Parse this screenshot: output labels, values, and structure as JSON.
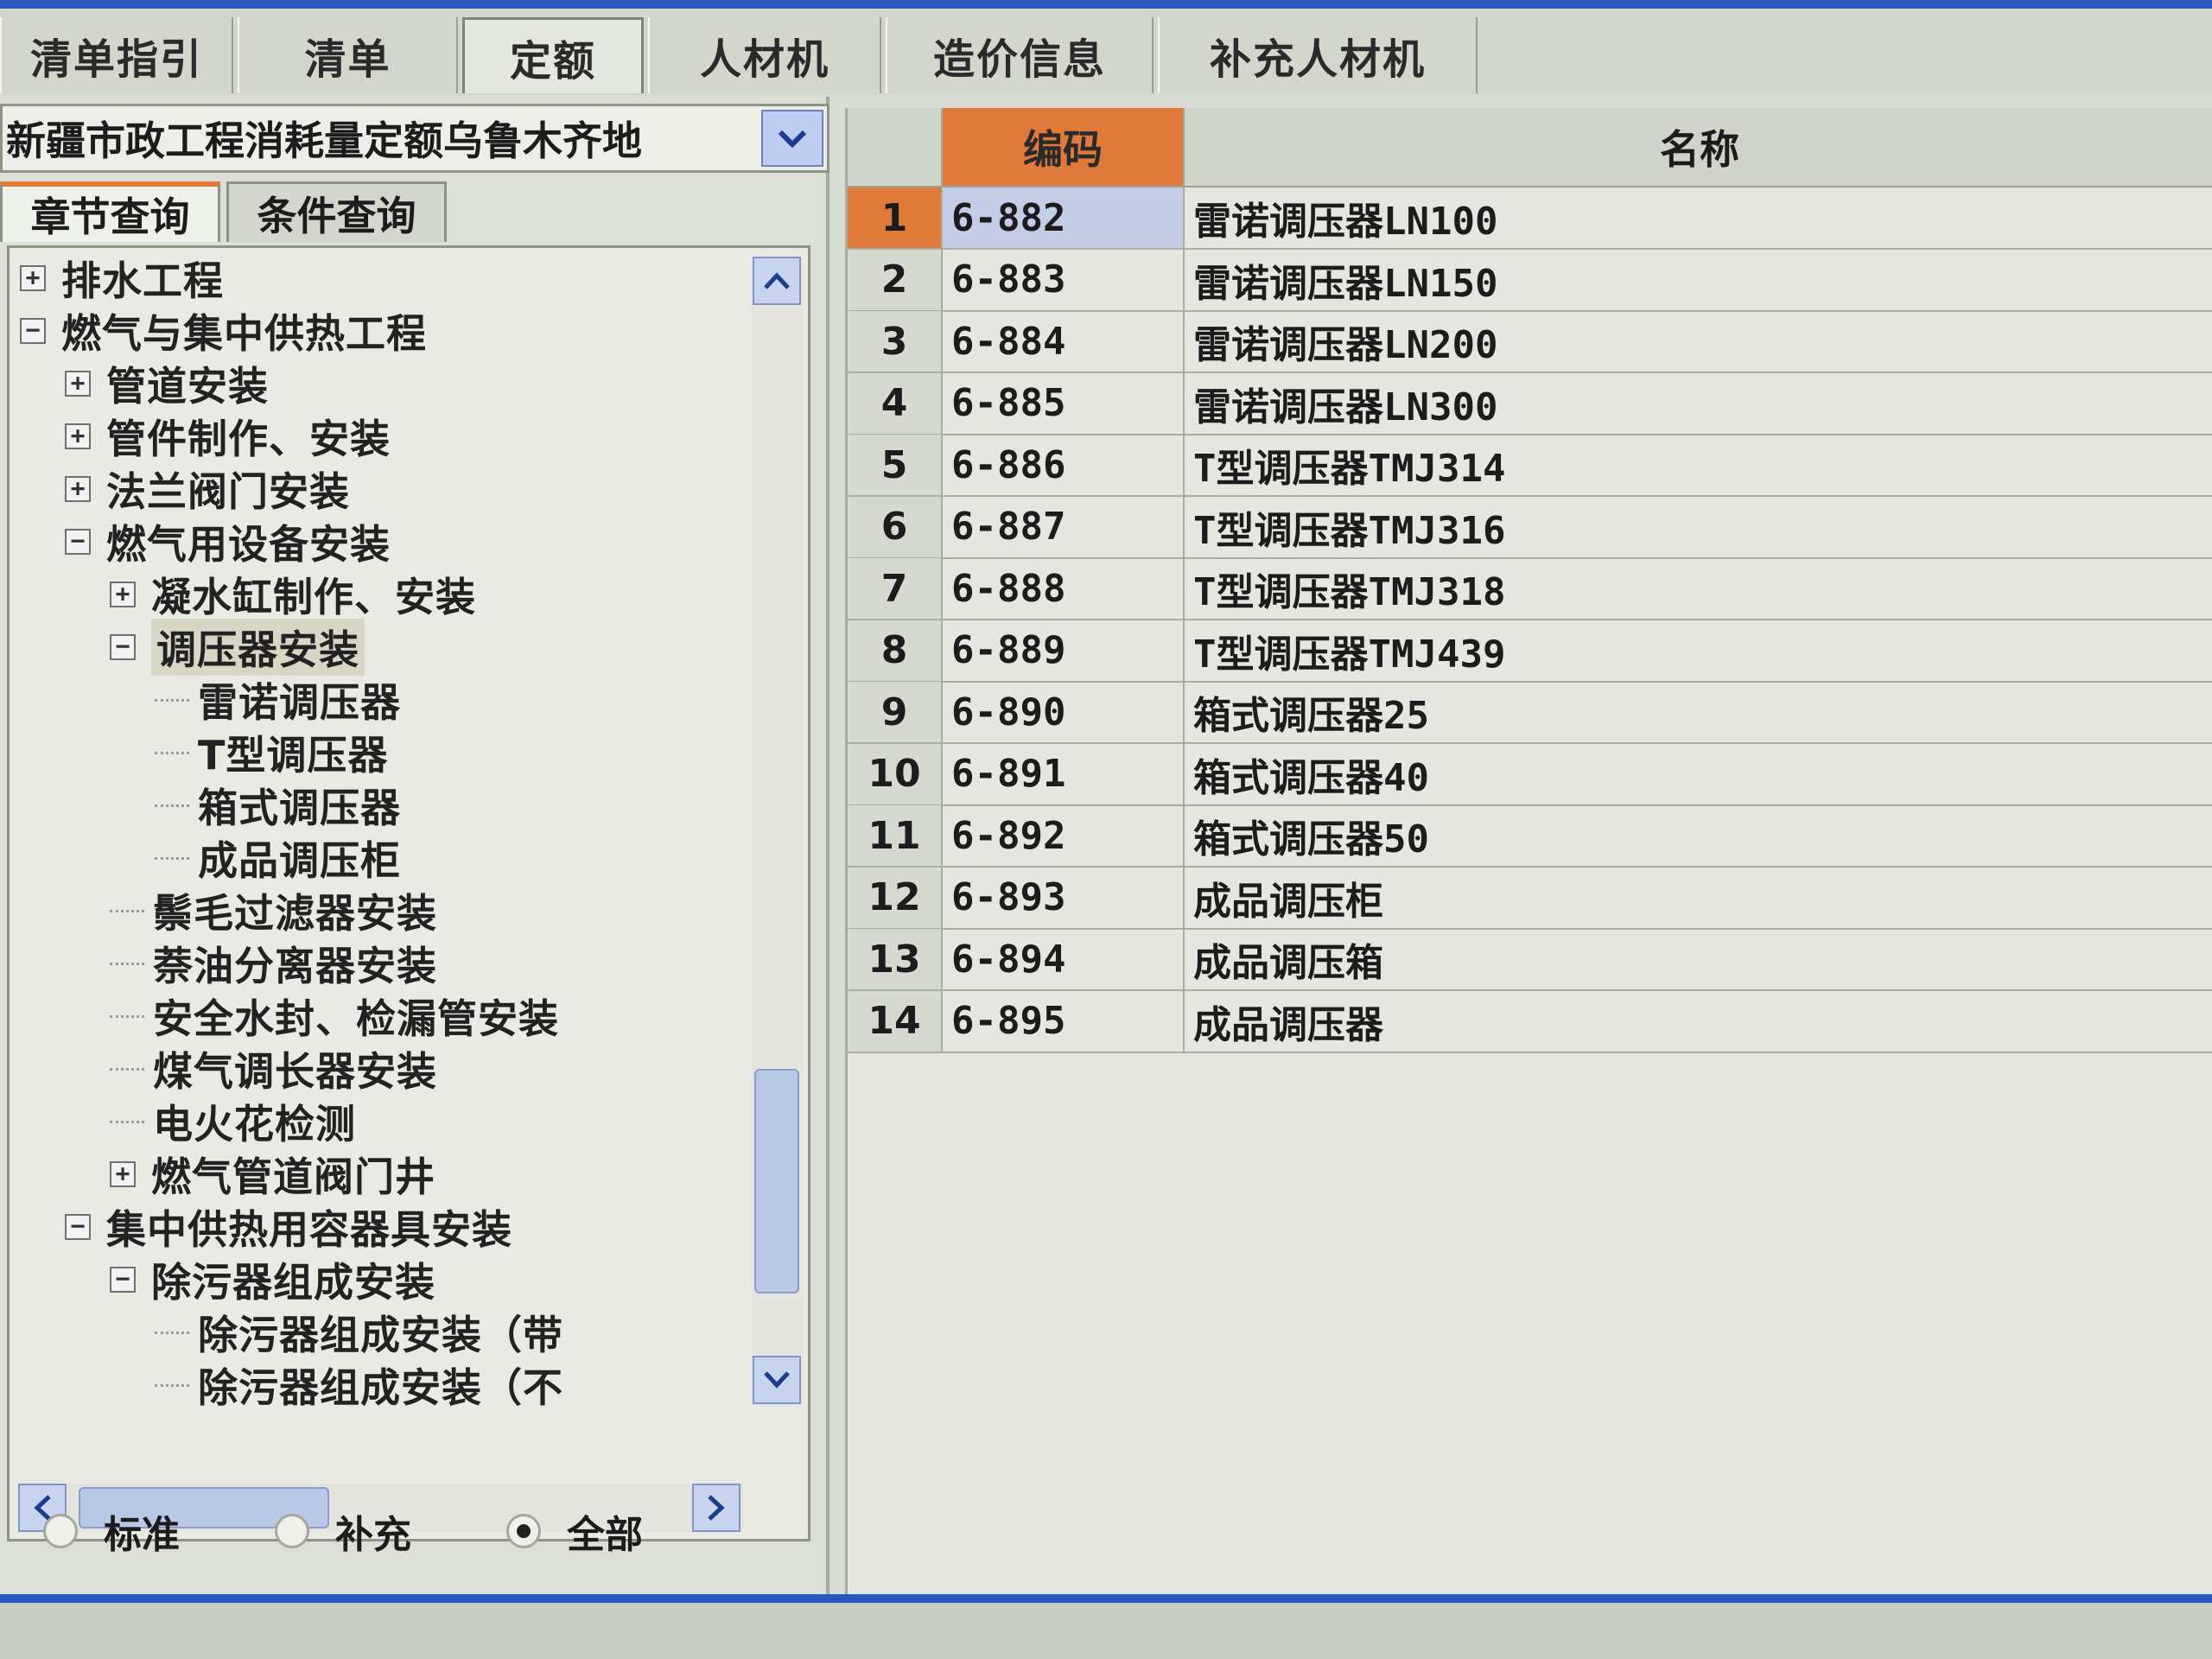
{
  "tabs": [
    {
      "label": "清单指引"
    },
    {
      "label": "清单"
    },
    {
      "label": "定额"
    },
    {
      "label": "人材机"
    },
    {
      "label": "造价信息"
    },
    {
      "label": "补充人材机"
    }
  ],
  "active_tab": "定额",
  "dropdown": {
    "value": "新疆市政工程消耗量定额乌鲁木齐地"
  },
  "query_tabs": [
    {
      "label": "章节查询"
    },
    {
      "label": "条件查询"
    }
  ],
  "tree": [
    {
      "label": "排水工程",
      "level": 0,
      "toggle": "+"
    },
    {
      "label": "燃气与集中供热工程",
      "level": 0,
      "toggle": "-"
    },
    {
      "label": "管道安装",
      "level": 1,
      "toggle": "+"
    },
    {
      "label": "管件制作、安装",
      "level": 1,
      "toggle": "+"
    },
    {
      "label": "法兰阀门安装",
      "level": 1,
      "toggle": "+"
    },
    {
      "label": "燃气用设备安装",
      "level": 1,
      "toggle": "-"
    },
    {
      "label": "凝水缸制作、安装",
      "level": 2,
      "toggle": "+"
    },
    {
      "label": "调压器安装",
      "level": 2,
      "toggle": "-",
      "selected": true
    },
    {
      "label": "雷诺调压器",
      "level": 3,
      "toggle": ""
    },
    {
      "label": "T型调压器",
      "level": 3,
      "toggle": ""
    },
    {
      "label": "箱式调压器",
      "level": 3,
      "toggle": ""
    },
    {
      "label": "成品调压柜",
      "level": 3,
      "toggle": ""
    },
    {
      "label": "鬃毛过滤器安装",
      "level": 2,
      "toggle": ""
    },
    {
      "label": "萘油分离器安装",
      "level": 2,
      "toggle": ""
    },
    {
      "label": "安全水封、检漏管安装",
      "level": 2,
      "toggle": ""
    },
    {
      "label": "煤气调长器安装",
      "level": 2,
      "toggle": ""
    },
    {
      "label": "电火花检测",
      "level": 2,
      "toggle": ""
    },
    {
      "label": "燃气管道阀门井",
      "level": 2,
      "toggle": "+"
    },
    {
      "label": "集中供热用容器具安装",
      "level": 1,
      "toggle": "-"
    },
    {
      "label": "除污器组成安装",
      "level": 2,
      "toggle": "-"
    },
    {
      "label": "除污器组成安装（带",
      "level": 3,
      "toggle": ""
    },
    {
      "label": "除污器组成安装（不",
      "level": 3,
      "toggle": ""
    }
  ],
  "radios": [
    {
      "label": "标准",
      "checked": false
    },
    {
      "label": "补充",
      "checked": false
    },
    {
      "label": "全部",
      "checked": true
    }
  ],
  "grid": {
    "headers": {
      "index": "",
      "code": "编码",
      "name": "名称"
    },
    "rows": [
      {
        "index": "1",
        "code": "6-882",
        "name": "雷诺调压器LN100"
      },
      {
        "index": "2",
        "code": "6-883",
        "name": "雷诺调压器LN150"
      },
      {
        "index": "3",
        "code": "6-884",
        "name": "雷诺调压器LN200"
      },
      {
        "index": "4",
        "code": "6-885",
        "name": "雷诺调压器LN300"
      },
      {
        "index": "5",
        "code": "6-886",
        "name": "T型调压器TMJ314"
      },
      {
        "index": "6",
        "code": "6-887",
        "name": "T型调压器TMJ316"
      },
      {
        "index": "7",
        "code": "6-888",
        "name": "T型调压器TMJ318"
      },
      {
        "index": "8",
        "code": "6-889",
        "name": "T型调压器TMJ439"
      },
      {
        "index": "9",
        "code": "6-890",
        "name": "箱式调压器25"
      },
      {
        "index": "10",
        "code": "6-891",
        "name": "箱式调压器40"
      },
      {
        "index": "11",
        "code": "6-892",
        "name": "箱式调压器50"
      },
      {
        "index": "12",
        "code": "6-893",
        "name": "成品调压柜"
      },
      {
        "index": "13",
        "code": "6-894",
        "name": "成品调压箱"
      },
      {
        "index": "14",
        "code": "6-895",
        "name": "成品调压器"
      }
    ],
    "selected_row": "1"
  },
  "colors": {
    "accent": "#e07a3a",
    "titlebar": "#2a57c4",
    "selection": "#c4cde6"
  },
  "icons": [
    "chevron-down-icon",
    "scroll-up-icon",
    "scroll-down-icon",
    "scroll-left-icon",
    "scroll-right-icon",
    "expand-icon",
    "collapse-icon"
  ]
}
